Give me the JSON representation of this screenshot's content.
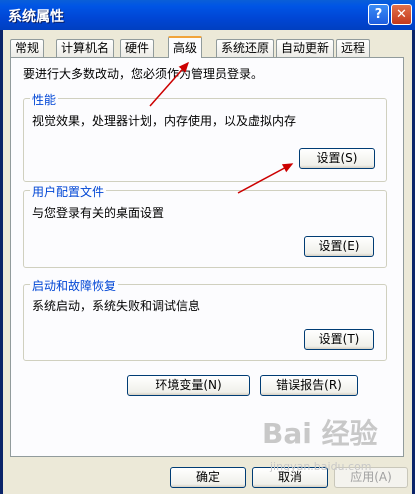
{
  "window": {
    "title": "系统属性",
    "help_glyph": "?",
    "close_glyph": "✕"
  },
  "tabs": [
    "常规",
    "计算机名",
    "硬件",
    "高级",
    "系统还原",
    "自动更新",
    "远程"
  ],
  "active_tab": "高级",
  "panel": {
    "note": "要进行大多数改动，您必须作为管理员登录。",
    "performance": {
      "title": "性能",
      "desc": "视觉效果，处理器计划，内存使用，以及虚拟内存",
      "button": "设置(S)"
    },
    "profile": {
      "title": "用户配置文件",
      "desc": "与您登录有关的桌面设置",
      "button": "设置(E)"
    },
    "startup": {
      "title": "启动和故障恢复",
      "desc": "系统启动，系统失败和调试信息",
      "button": "设置(T)"
    },
    "env_button": "环境变量(N)",
    "error_button": "错误报告(R)"
  },
  "footer": {
    "ok": "确定",
    "cancel": "取消",
    "apply": "应用(A)"
  },
  "watermark": {
    "logo": "Bai 经验",
    "url": "jingyan.baidu.com"
  },
  "annotation_color": "#cc0000"
}
